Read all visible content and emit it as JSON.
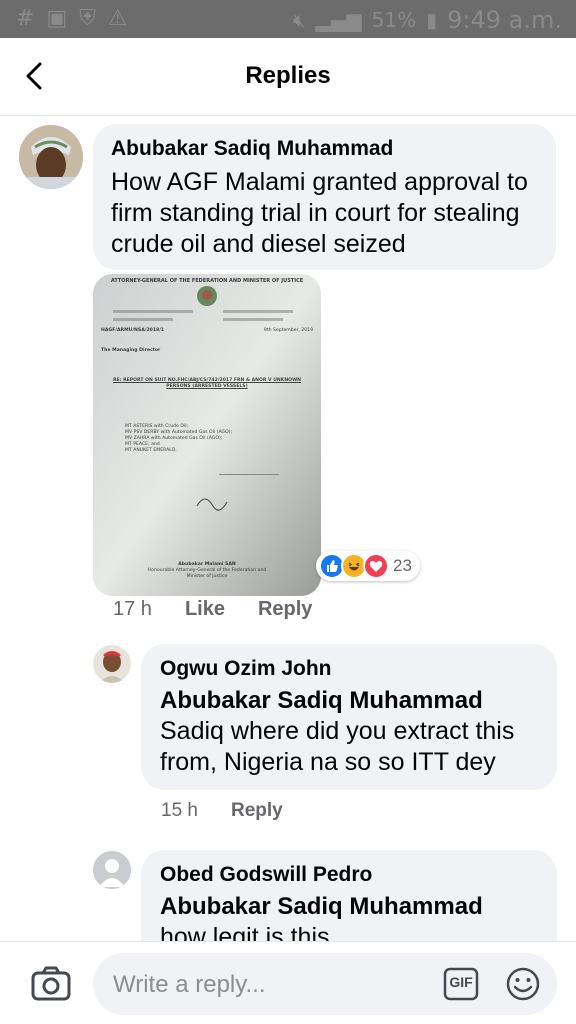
{
  "status_bar": {
    "battery": "51%",
    "time": "9:49 a.m."
  },
  "header": {
    "title": "Replies"
  },
  "main_comment": {
    "author": "Abubakar Sadiq Muhammad",
    "text": "How AGF Malami granted approval to firm standing trial in court for stealing crude oil and diesel seized",
    "time": "17 h",
    "like_label": "Like",
    "reply_label": "Reply",
    "reactions": {
      "icons": [
        "like-icon",
        "haha-icon",
        "love-icon"
      ],
      "count": "23"
    },
    "attachment": {
      "letterhead_left": "ATTORNEY-GENERAL OF THE FEDERATION AND MINISTER OF JUSTICE",
      "ref": "HAGF/ARMU/NSA/2018/1",
      "date": "9th September, 2019",
      "addressee": "The Managing Director",
      "subject": "RE: REPORT ON SUIT NO.FHC/ABJ/CS/742/2017 FRN & ANOR V UNKNOWN PERSONS (ARRESTED VESSELS)",
      "items": [
        "MT ASTERIS with Crude Oil;",
        "MV PSV DERBY with Automated Gas Oil (AGO);",
        "MV ZAHRA with Automated Gas Oil (AGO);",
        "MT PEACE; and",
        "MT ANUKET EMERALD."
      ],
      "signatory": "Abubakar Malami SAN",
      "signatory_title": "Honourable Attorney-General of the Federation and Minister of Justice"
    }
  },
  "replies": [
    {
      "author": "Ogwu Ozim John",
      "tag": "Abubakar Sadiq Muhammad",
      "text": "Sadiq where did you extract this from, Nigeria na so so ITT dey",
      "time": "15 h",
      "reply_label": "Reply"
    },
    {
      "author": "Obed Godswill Pedro",
      "tag": "Abubakar Sadiq Muhammad",
      "text": "how legit is this"
    }
  ],
  "composer": {
    "placeholder": "Write a reply...",
    "gif_label": "GIF"
  },
  "colors": {
    "bubble": "#f0f2f5",
    "like_blue": "#1877f2",
    "love_red": "#f33e58",
    "haha_yellow": "#f7b125",
    "muted": "#65676b"
  }
}
